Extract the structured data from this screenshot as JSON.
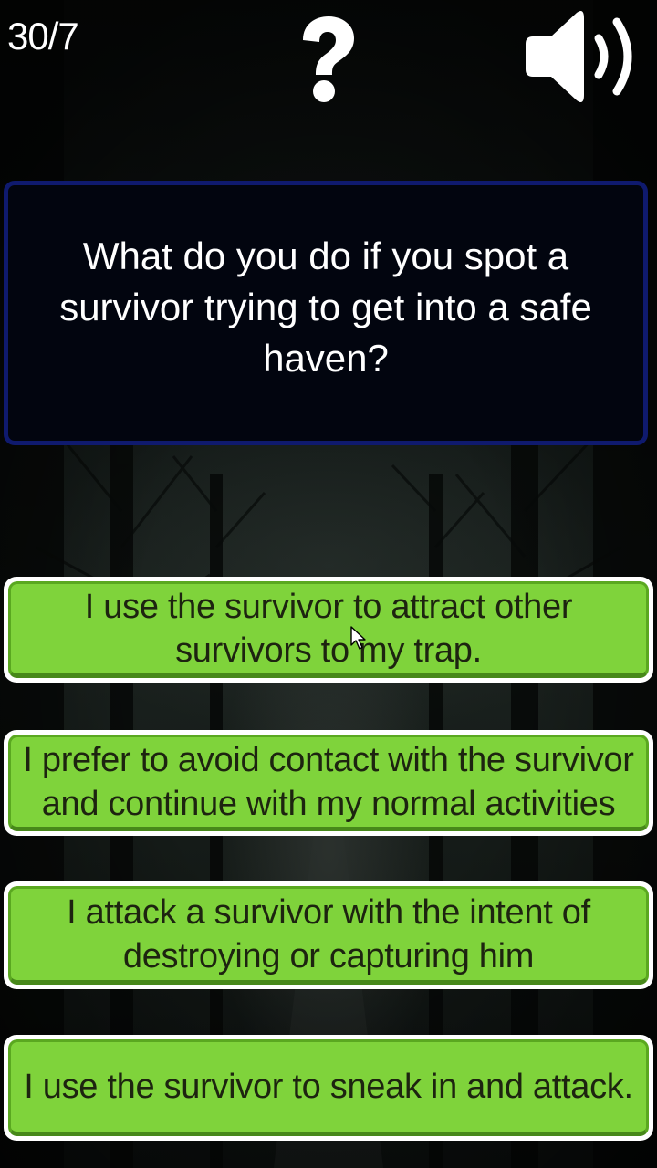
{
  "header": {
    "score": "30/7",
    "help_icon": "question-mark-icon",
    "sound_icon": "speaker-on-icon"
  },
  "question": {
    "text": "What do you do if you spot a survivor trying to get into a safe haven?"
  },
  "answers": [
    {
      "label": "I use the survivor to attract other survivors to my trap."
    },
    {
      "label": "I prefer to avoid contact with the survivor and continue with my normal activities"
    },
    {
      "label": "I attack a survivor with the intent of destroying or capturing him"
    },
    {
      "label": "I use the survivor to sneak in and attack."
    }
  ],
  "colors": {
    "question_bg": "#02050f",
    "question_border": "#0f1a6e",
    "answer_green": "#7fd33b",
    "answer_outline": "#ffffff"
  }
}
